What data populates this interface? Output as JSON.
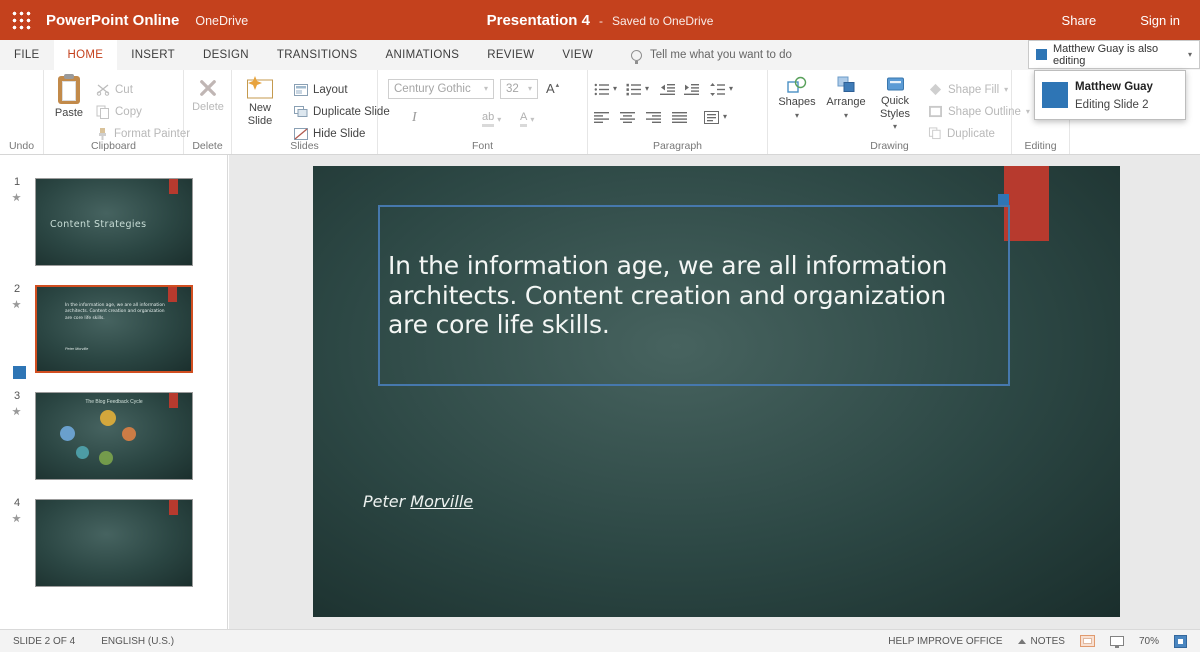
{
  "topbar": {
    "app_title": "PowerPoint Online",
    "onedrive_label": "OneDrive",
    "doc_title": "Presentation 4",
    "separator": "-",
    "saved_status": "Saved to OneDrive",
    "share_label": "Share",
    "signin_label": "Sign in"
  },
  "tabs": {
    "file": "FILE",
    "home": "HOME",
    "insert": "INSERT",
    "design": "DESIGN",
    "transitions": "TRANSITIONS",
    "animations": "ANIMATIONS",
    "review": "REVIEW",
    "view": "VIEW",
    "tellme": "Tell me what you want to do",
    "presence_label": "Matthew Guay is also editing"
  },
  "presence_popup": {
    "name": "Matthew Guay",
    "status": "Editing Slide 2"
  },
  "ribbon": {
    "undo": {
      "label": "Undo"
    },
    "clipboard": {
      "label": "Clipboard",
      "paste": "Paste",
      "cut": "Cut",
      "copy": "Copy",
      "format_painter": "Format Painter"
    },
    "delete_group": {
      "label": "Delete",
      "delete_btn": "Delete"
    },
    "slides_group": {
      "label": "Slides",
      "new_slide": "New Slide",
      "layout": "Layout",
      "duplicate_slide": "Duplicate Slide",
      "hide_slide": "Hide Slide"
    },
    "font_group": {
      "label": "Font",
      "font_name": "Century Gothic",
      "font_size": "32",
      "italic_glyph": "I",
      "grow_font_glyph": "A"
    },
    "paragraph_group": {
      "label": "Paragraph"
    },
    "drawing_group": {
      "label": "Drawing",
      "shapes": "Shapes",
      "arrange": "Arrange",
      "quick_styles": "Quick Styles",
      "shape_fill": "Shape Fill",
      "shape_outline": "Shape Outline",
      "duplicate": "Duplicate"
    },
    "editing_group": {
      "label": "Editing"
    }
  },
  "icons": {
    "caret": "▾",
    "caret_up": "▴"
  },
  "slides_panel": {
    "slide1": {
      "number": "1",
      "title": "Content Strategies"
    },
    "slide2": {
      "number": "2",
      "quote": "In the information age, we are all information architects. Content creation and organization are core life skills.",
      "author": "Peter Morville"
    },
    "slide3": {
      "number": "3",
      "title": "The Blog Feedback Cycle",
      "c1_style": "background:#dfae3a",
      "c2_style": "background:#d97f44",
      "c3_style": "background:#6fa7d8",
      "c4_style": "background:#4fa3ad",
      "c5_style": "background:#79a24c"
    },
    "slide4": {
      "number": "4"
    }
  },
  "slide_canvas": {
    "quote_line1": "In the information age, we are all information",
    "quote_line2": "architects. Content creation and organization",
    "quote_line3": "are core life skills.",
    "author_first": "Peter ",
    "author_last": "Morville"
  },
  "statusbar": {
    "slide_info": "SLIDE 2 OF 4",
    "language": "ENGLISH (U.S.)",
    "help": "HELP IMPROVE OFFICE",
    "notes": "NOTES",
    "zoom": "70%"
  },
  "colors": {
    "brand_red": "#c4411d",
    "slide_accent_red": "#b73a2e",
    "presence_blue": "#2e75b5",
    "selection_orange": "#d14e20"
  }
}
